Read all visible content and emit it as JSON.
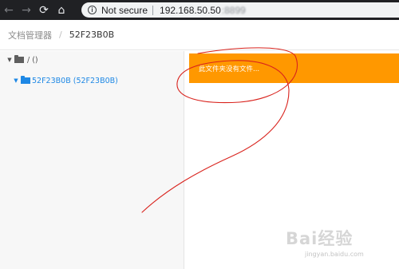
{
  "browser": {
    "back_icon": "←",
    "forward_icon": "→",
    "reload_icon": "⟳",
    "home_icon": "⌂",
    "info_icon": "i",
    "security_label": "Not secure",
    "url": "192.168.50.50",
    "url_blurred": ":8899"
  },
  "breadcrumb": {
    "root": "文档管理器",
    "separator": "/",
    "current": "52F23B0B"
  },
  "tree": {
    "root": {
      "caret": "▼",
      "label": "/ ()"
    },
    "child": {
      "caret": "▼",
      "label": "52F23B0B (52F23B0B)"
    }
  },
  "content": {
    "alert_text": "此文件夹没有文件..."
  },
  "watermark": {
    "brand": "Bai经验",
    "domain": "jingyan.baidu.com"
  },
  "colors": {
    "alert_bg": "#ff9800",
    "link_blue": "#1e88e5",
    "annotation_red": "#d9231d"
  }
}
